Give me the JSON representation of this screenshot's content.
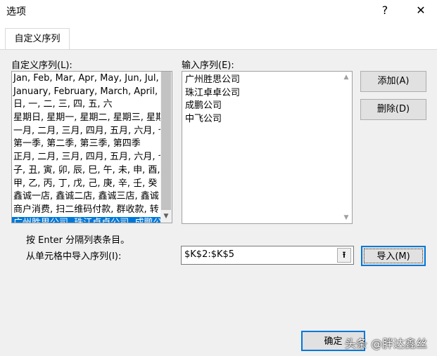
{
  "window": {
    "title": "选项",
    "help": "?",
    "close": "✕"
  },
  "tabs": [
    {
      "label": "自定义序列"
    }
  ],
  "lists": {
    "label": "自定义序列(L):",
    "items": [
      "Jan, Feb, Mar, Apr, May, Jun, Jul,",
      "January, February, March, April, I",
      "日, 一, 二, 三, 四, 五, 六",
      "星期日, 星期一, 星期二, 星期三, 星期",
      "一月, 二月, 三月, 四月, 五月, 六月, 七",
      "第一季, 第二季, 第三季, 第四季",
      "正月, 二月, 三月, 四月, 五月, 六月, 七",
      "子, 丑, 寅, 卯, 辰, 巳, 午, 未, 申, 酉, 戌",
      "甲, 乙, 丙, 丁, 戊, 己, 庚, 辛, 壬, 癸",
      "鑫诚一店, 鑫诚二店, 鑫诚三店, 鑫诚",
      "商户消费, 扫二维码付款, 群收款, 转",
      "广州胜思公司, 珠江卓卓公司, 成鹏公"
    ],
    "selected_index": 11
  },
  "entries": {
    "label": "输入序列(E):",
    "items": [
      "广州胜思公司",
      "珠江卓卓公司",
      "成鹏公司",
      "中飞公司"
    ]
  },
  "buttons": {
    "add": "添加(A)",
    "delete": "删除(D)",
    "import": "导入(M)",
    "ok": "确定"
  },
  "hint": "按 Enter 分隔列表条目。",
  "import_label": "从单元格中导入序列(I):",
  "import_range": "$K$2:$K$5",
  "watermark": "头条 @胖达鑫丝"
}
